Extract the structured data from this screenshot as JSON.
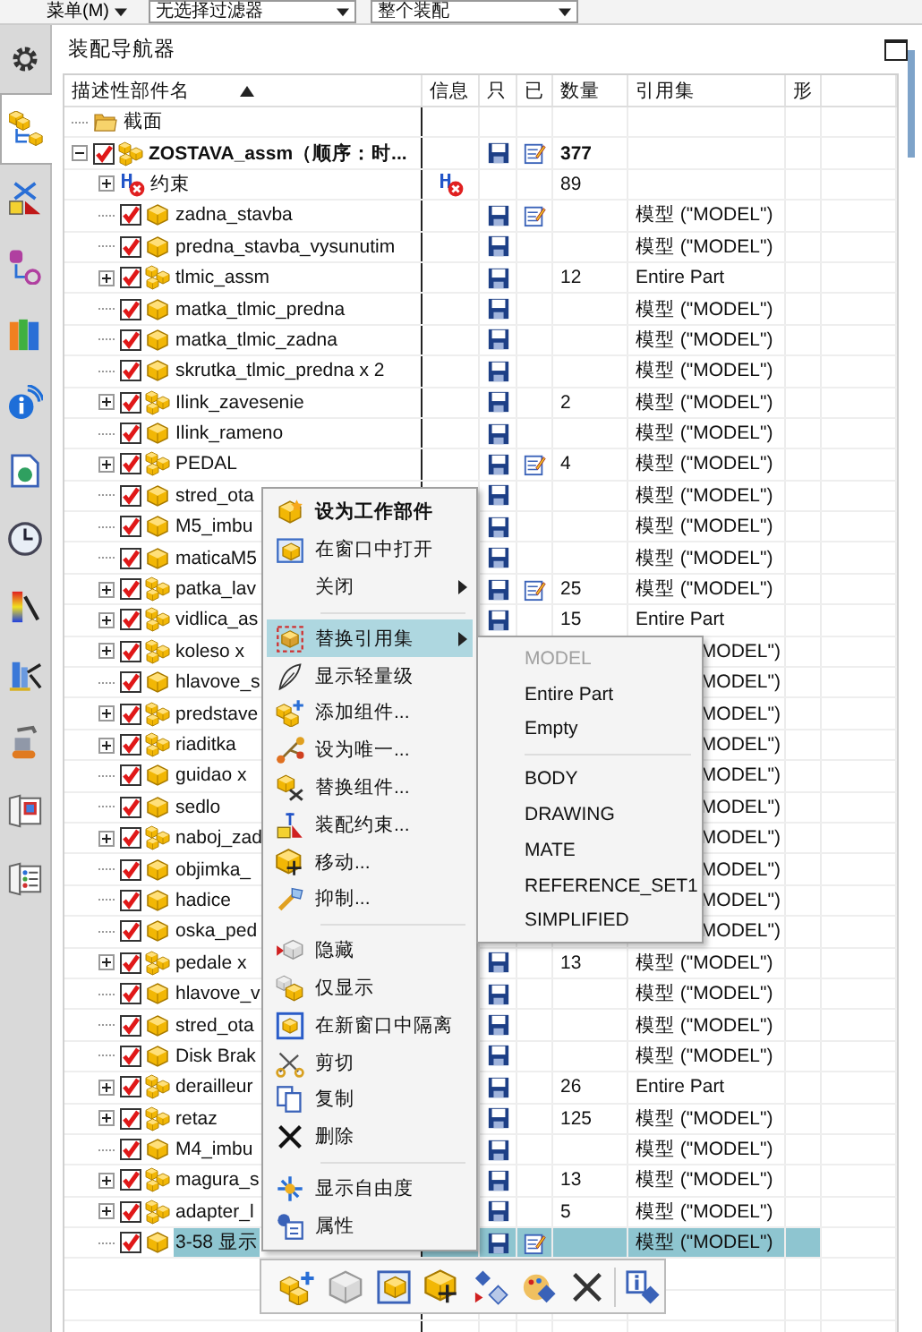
{
  "toolbar": {
    "menu_label": "菜单(M)",
    "filters": [
      {
        "value": "无选择过滤器"
      },
      {
        "value": "整个装配"
      }
    ]
  },
  "side_tabs": [
    {
      "selected": false
    },
    {
      "selected": true
    },
    {
      "selected": false
    },
    {
      "selected": false
    },
    {
      "selected": false
    },
    {
      "selected": false
    },
    {
      "selected": false
    },
    {
      "selected": false
    },
    {
      "selected": false
    },
    {
      "selected": false
    },
    {
      "selected": false
    },
    {
      "selected": false
    },
    {
      "selected": false
    }
  ],
  "navigator": {
    "title": "装配导航器",
    "columns": [
      {
        "label": "描述性部件名",
        "sorted": true
      },
      {
        "label": "信息"
      },
      {
        "label": "只"
      },
      {
        "label": "已"
      },
      {
        "label": "数量"
      },
      {
        "label": "引用集"
      },
      {
        "label": "形"
      }
    ],
    "rows": [
      {
        "name": "截面",
        "kind": "folder",
        "selected": false
      },
      {
        "name": "ZOSTAVA_assm（顺序：时...",
        "kind": "assembly",
        "work_part": true,
        "checked": true,
        "expanded": true,
        "saved": true,
        "modified": true,
        "quantity": "377",
        "selected": false,
        "children": [
          {
            "name": "约束",
            "kind": "constraints",
            "expanded": false,
            "info": true,
            "quantity": "89",
            "selected": false
          },
          {
            "name": "zadna_stavba",
            "kind": "part",
            "checked": true,
            "saved": true,
            "modified": true,
            "reference_set": "模型 (\"MODEL\")",
            "selected": false
          },
          {
            "name": "predna_stavba_vysunutim",
            "kind": "part",
            "checked": true,
            "saved": true,
            "reference_set": "模型 (\"MODEL\")",
            "selected": false
          },
          {
            "name": "tlmic_assm",
            "kind": "assembly",
            "checked": true,
            "expanded": false,
            "saved": true,
            "quantity": "12",
            "reference_set": "Entire Part",
            "selected": false
          },
          {
            "name": "matka_tlmic_predna",
            "kind": "part",
            "checked": true,
            "saved": true,
            "reference_set": "模型 (\"MODEL\")",
            "selected": false
          },
          {
            "name": "matka_tlmic_zadna",
            "kind": "part",
            "checked": true,
            "saved": true,
            "reference_set": "模型 (\"MODEL\")",
            "selected": false
          },
          {
            "name": "skrutka_tlmic_predna x 2",
            "kind": "part",
            "checked": true,
            "saved": true,
            "reference_set": "模型 (\"MODEL\")",
            "selected": false
          },
          {
            "name": "Ilink_zavesenie",
            "kind": "assembly",
            "checked": true,
            "expanded": false,
            "saved": true,
            "quantity": "2",
            "reference_set": "模型 (\"MODEL\")",
            "selected": false
          },
          {
            "name": "Ilink_rameno",
            "kind": "part",
            "checked": true,
            "saved": true,
            "reference_set": "模型 (\"MODEL\")",
            "selected": false
          },
          {
            "name": "PEDAL",
            "kind": "assembly",
            "checked": true,
            "expanded": false,
            "saved": true,
            "modified": true,
            "quantity": "4",
            "reference_set": "模型 (\"MODEL\")",
            "selected": false
          },
          {
            "name": "stred_ota",
            "kind": "part",
            "checked": true,
            "saved": true,
            "reference_set": "模型 (\"MODEL\")",
            "selected": false
          },
          {
            "name": "M5_imbu",
            "kind": "part",
            "checked": true,
            "saved": true,
            "reference_set": "模型 (\"MODEL\")",
            "selected": false
          },
          {
            "name": "maticaM5",
            "kind": "part",
            "checked": true,
            "saved": true,
            "reference_set": "模型 (\"MODEL\")",
            "selected": false
          },
          {
            "name": "patka_lav",
            "kind": "assembly",
            "checked": true,
            "expanded": false,
            "saved": true,
            "modified": true,
            "quantity": "25",
            "reference_set": "模型 (\"MODEL\")",
            "selected": false
          },
          {
            "name": "vidlica_as",
            "kind": "assembly",
            "checked": true,
            "expanded": false,
            "saved": true,
            "quantity": "15",
            "reference_set": "Entire Part",
            "selected": false
          },
          {
            "name": "koleso x",
            "kind": "assembly",
            "checked": true,
            "expanded": false,
            "reference_set": "MODEL\")",
            "selected": false
          },
          {
            "name": "hlavove_s",
            "kind": "part",
            "checked": true,
            "reference_set": "MODEL\")",
            "selected": false
          },
          {
            "name": "predstave",
            "kind": "assembly",
            "checked": true,
            "expanded": false,
            "reference_set": "MODEL\")",
            "selected": false
          },
          {
            "name": "riaditka",
            "kind": "assembly",
            "checked": true,
            "expanded": false,
            "reference_set": "MODEL\")",
            "selected": false
          },
          {
            "name": "guidao x",
            "kind": "part",
            "checked": true,
            "reference_set": "MODEL\")",
            "selected": false
          },
          {
            "name": "sedlo",
            "kind": "part",
            "checked": true,
            "reference_set": "MODEL\")",
            "selected": false
          },
          {
            "name": "naboj_zad",
            "kind": "assembly",
            "checked": true,
            "expanded": false,
            "reference_set": "MODEL\")",
            "selected": false
          },
          {
            "name": "objimka_",
            "kind": "part",
            "checked": true,
            "reference_set": "MODEL\")",
            "selected": false
          },
          {
            "name": "hadice",
            "kind": "part",
            "checked": true,
            "reference_set": "MODEL\")",
            "selected": false
          },
          {
            "name": "oska_ped",
            "kind": "part",
            "checked": true,
            "reference_set": "MODEL\")",
            "selected": false
          },
          {
            "name": "pedale x",
            "kind": "assembly",
            "checked": true,
            "expanded": false,
            "saved": true,
            "quantity": "13",
            "reference_set": "模型 (\"MODEL\")",
            "selected": false
          },
          {
            "name": "hlavove_v",
            "kind": "part",
            "checked": true,
            "saved": true,
            "reference_set": "模型 (\"MODEL\")",
            "selected": false
          },
          {
            "name": "stred_ota",
            "kind": "part",
            "checked": true,
            "saved": true,
            "reference_set": "模型 (\"MODEL\")",
            "selected": false
          },
          {
            "name": "Disk Brak",
            "kind": "part",
            "checked": true,
            "saved": true,
            "reference_set": "模型 (\"MODEL\")",
            "selected": false
          },
          {
            "name": "derailleur",
            "kind": "assembly",
            "checked": true,
            "expanded": false,
            "saved": true,
            "quantity": "26",
            "reference_set": "Entire Part",
            "selected": false
          },
          {
            "name": "retaz",
            "kind": "assembly",
            "checked": true,
            "expanded": false,
            "saved": true,
            "quantity": "125",
            "reference_set": "模型 (\"MODEL\")",
            "selected": false
          },
          {
            "name": "M4_imbu",
            "kind": "part",
            "checked": true,
            "saved": true,
            "reference_set": "模型 (\"MODEL\")",
            "selected": false
          },
          {
            "name": "magura_s",
            "kind": "assembly",
            "checked": true,
            "expanded": false,
            "saved": true,
            "quantity": "13",
            "reference_set": "模型 (\"MODEL\")",
            "selected": false
          },
          {
            "name": "adapter_l",
            "kind": "assembly",
            "checked": true,
            "expanded": false,
            "saved": true,
            "quantity": "5",
            "reference_set": "模型 (\"MODEL\")",
            "selected": false
          },
          {
            "name": "3-58 显示",
            "kind": "part",
            "checked": true,
            "saved": true,
            "modified": true,
            "reference_set": "模型 (\"MODEL\")",
            "selected": true
          }
        ]
      }
    ]
  },
  "context_menu": {
    "items": [
      {
        "kind": "item",
        "label": "设为工作部件",
        "bold": true,
        "submenu": false,
        "selected": false
      },
      {
        "kind": "item",
        "label": "在窗口中打开",
        "submenu": false,
        "selected": false
      },
      {
        "kind": "item",
        "label": "关闭",
        "submenu": true,
        "selected": false
      },
      {
        "kind": "separator"
      },
      {
        "kind": "item",
        "label": "替换引用集",
        "submenu": true,
        "selected": true
      },
      {
        "kind": "item",
        "label": "显示轻量级",
        "submenu": false,
        "selected": false
      },
      {
        "kind": "item",
        "label": "添加组件...",
        "submenu": false,
        "selected": false
      },
      {
        "kind": "item",
        "label": "设为唯一...",
        "submenu": false,
        "selected": false
      },
      {
        "kind": "item",
        "label": "替换组件...",
        "submenu": false,
        "selected": false
      },
      {
        "kind": "item",
        "label": "装配约束...",
        "submenu": false,
        "selected": false
      },
      {
        "kind": "item",
        "label": "移动...",
        "submenu": false,
        "selected": false
      },
      {
        "kind": "item",
        "label": "抑制...",
        "submenu": false,
        "selected": false
      },
      {
        "kind": "separator"
      },
      {
        "kind": "item",
        "label": "隐藏",
        "submenu": false,
        "selected": false
      },
      {
        "kind": "item",
        "label": "仅显示",
        "submenu": false,
        "selected": false
      },
      {
        "kind": "item",
        "label": "在新窗口中隔离",
        "submenu": false,
        "selected": false
      },
      {
        "kind": "item",
        "label": "剪切",
        "submenu": false,
        "selected": false
      },
      {
        "kind": "item",
        "label": "复制",
        "submenu": false,
        "selected": false
      },
      {
        "kind": "item",
        "label": "删除",
        "submenu": false,
        "selected": false
      },
      {
        "kind": "separator"
      },
      {
        "kind": "item",
        "label": "显示自由度",
        "submenu": false,
        "selected": false
      },
      {
        "kind": "item",
        "label": "属性",
        "submenu": false,
        "selected": false
      }
    ]
  },
  "reference_set_submenu": {
    "items": [
      {
        "kind": "item",
        "label": "MODEL",
        "disabled": true
      },
      {
        "kind": "item",
        "label": "Entire Part",
        "disabled": false
      },
      {
        "kind": "item",
        "label": "Empty",
        "disabled": false
      },
      {
        "kind": "separator"
      },
      {
        "kind": "item",
        "label": "BODY",
        "disabled": false
      },
      {
        "kind": "item",
        "label": "DRAWING",
        "disabled": false
      },
      {
        "kind": "item",
        "label": "MATE",
        "disabled": false
      },
      {
        "kind": "item",
        "label": "REFERENCE_SET1",
        "disabled": false
      },
      {
        "kind": "item",
        "label": "SIMPLIFIED",
        "disabled": false
      }
    ]
  }
}
